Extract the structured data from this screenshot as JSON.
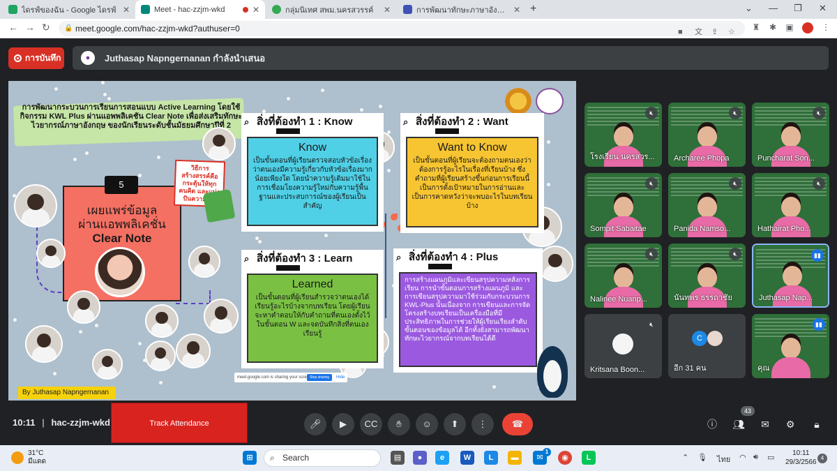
{
  "browser": {
    "tabs": [
      {
        "label": "ไดรฟ์ของฉัน - Google ไดรฟ์",
        "favicon_color": "#1fa463"
      },
      {
        "label": "Meet - hac-zzjm-wkd",
        "favicon_color": "#00897b"
      },
      {
        "label": "กลุ่มนิเทศ สพม.นครสวรรค์",
        "favicon_color": "#34a853"
      },
      {
        "label": "การพัฒนาทักษะภาษาอังกฤษ English",
        "favicon_color": "#3f51b5"
      }
    ],
    "url": "meet.google.com/hac-zzjm-wkd?authuser=0",
    "new_tab": "+",
    "window_controls": [
      "⌄",
      "—",
      "❐",
      "✕"
    ]
  },
  "meet": {
    "record_label": "การบันทึก",
    "presenting_text": "Juthasap Napngernanan กำลังนำเสนอ",
    "meeting_time": "10:11",
    "meeting_code": "hac-zzjm-wkd",
    "track_attendance": "Track Attendance",
    "participants_count": "43",
    "others_label": "อีก 31 คน",
    "others_initial": "C"
  },
  "slide": {
    "title": "การพัฒนากระบวนการเรียนการสอนแบบ Active Learning โดยใช้กิจกรรม KWL Plus ผ่านแอพพลิเคชัน Clear Note เพื่อส่งเสริมทักษะไวยากรณ์ภาษาอังกฤษ ของนักเรียนระดับชั้นมัธยมศึกษาปีที่ 2",
    "step_number": "5",
    "central_line1": "เผยแพร่ข้อมูล",
    "central_line2": "ผ่านแอพพลิเคชั่น",
    "central_line3": "Clear Note",
    "note": "วิธีการสร้างสรรค์คือ กระตุ้นให้ทุกคนคิด และแบ่งปันความคิด",
    "byline": "By Juthasap Napngernanan",
    "share_text": "meet.google.com is sharing your screen.",
    "share_stop": "Stop sharing",
    "share_hide": "Hide",
    "cards": [
      {
        "header": "สิ่งที่ต้องทำ 1 : Know",
        "big": "Know",
        "body": "เป็นขั้นตอนที่ผู้เรียนตรวจสอบหัวข้อเรื่องว่าตนเองมีความรู้เกี่ยวกับหัวข้อเรื่องมากน้อยเพียงใด โดยนำความรู้เดิมมาใช้ในการเชื่อมโยงความรู้ใหม่กับความรู้พื้นฐานและประสบการณ์ของผู้เรียนเป็นสำคัญ",
        "color": "#4fd0e6"
      },
      {
        "header": "สิ่งที่ต้องทำ 2 : Want",
        "big": "Want to Know",
        "body": "เป็นขั้นตอนที่ผู้เรียนจะต้องถามตนเองว่า ต้องการรู้อะไรในเรื่องที่เรียนบ้าง ซึ่งคำถามที่ผู้เรียนสร้างขึ้นก่อนการเรียนนี้ เป็นการตั้งเป้าหมายในการอ่านและเป็นการคาดหวังว่าจะพบอะไรในบทเรียนบ้าง",
        "color": "#f7c531"
      },
      {
        "header": "สิ่งที่ต้องทำ 3 : Learn",
        "big": "Learned",
        "body": "เป็นขั้นตอนที่ผู้เรียนสำรวจว่าตนเองได้เรียนรู้อะไรบ้างจากบทเรียน โดยผู้เรียนจะหาคำตอบให้กับคำถามที่ตนเองตั้งไว้ในขั้นตอน W และจดบันทึกสิ่งที่ตนเองเรียนรู้",
        "color": "#7ac143"
      },
      {
        "header": "สิ่งที่ต้องทำ 4 : Plus",
        "big": "",
        "body": "การสร้างแผนภูมิและเขียนสรุปความหลังการเรียน การนำขั้นตอนการสร้างแผนภูมิ และการเขียนสรุปความมาใช้ร่วมกับกระบวนการ KWL-Plus นั้นเนื่องจาก การเขียนและการจัดโครงสร้างบทเรียนเป็นเครื่องมือที่มีประสิทธิภาพในการช่วยให้ผู้เรียนเรียงลำดับขั้นตอนของข้อมูลได้ อีกทั้งยังสามารถพัฒนาทักษะไวยากรณ์จากบทเรียนได้ดี",
        "color": "#9b59e0"
      }
    ]
  },
  "participants": [
    {
      "name": "โรงเรียน นครสวร...",
      "muted": true
    },
    {
      "name": "Archaree Phopa",
      "muted": true
    },
    {
      "name": "Puncharat Son...",
      "muted": true
    },
    {
      "name": "Sompit Sabaitae",
      "muted": true
    },
    {
      "name": "Panida Namso...",
      "muted": true
    },
    {
      "name": "Hathairat Pho...",
      "muted": true
    },
    {
      "name": "Nalinee Nuanp...",
      "muted": true
    },
    {
      "name": "นันทพร ธรรถาชัย",
      "muted": true
    },
    {
      "name": "Juthasap Nap...",
      "muted": false
    },
    {
      "name": "Kritsana Boon...",
      "muted": true
    },
    {
      "name": "คุณ",
      "muted": false
    }
  ],
  "taskbar": {
    "temperature": "31°C",
    "weather_text": "มีแดด",
    "search_placeholder": "Search",
    "language": "ไทย",
    "time": "10:11",
    "date": "29/3/2566",
    "notifications": "4",
    "mail_badge": "1"
  }
}
